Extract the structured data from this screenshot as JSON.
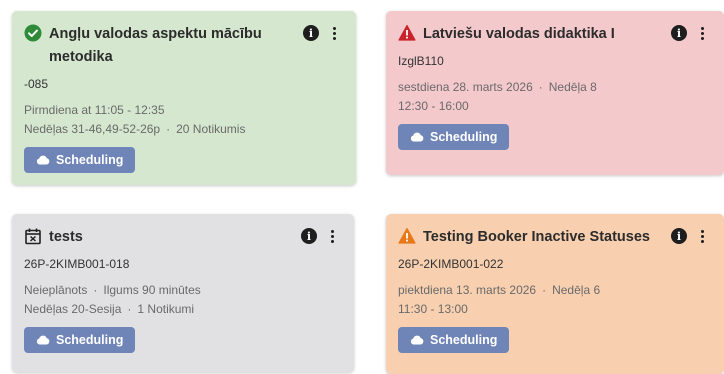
{
  "cards": [
    {
      "title": "Angļu valodas aspektu mācību metodika",
      "code": "-085",
      "line1": "Pirmdiena at 11:05 - 12:35",
      "line2a": "Nedēļas 31-46,49-52-26p",
      "line2b": "20 Notikumis",
      "separator": "·",
      "button": "Scheduling",
      "status_icon": "check-circle-icon",
      "color": "#d5e7cf"
    },
    {
      "title": "Latviešu valodas didaktika I",
      "code": "IzglB110",
      "line1a": "sestdiena 28. marts 2026",
      "line1b": "Nedēļa 8",
      "line2": "12:30 - 16:00",
      "separator": "·",
      "button": "Scheduling",
      "status_icon": "warning-triangle-icon",
      "color": "#f4c9cc"
    },
    {
      "title": "tests",
      "code": "26P-2KIMB001-018",
      "line1a": "Neieplānots",
      "line1b": "Ilgums 90 minūtes",
      "line2a": "Nedēļas 20-Sesija",
      "line2b": "1 Notikumi",
      "separator": "·",
      "button": "Scheduling",
      "status_icon": "calendar-x-icon",
      "color": "#e1e1e3"
    },
    {
      "title": "Testing Booker Inactive Statuses",
      "code": "26P-2KIMB001-022",
      "line1a": "piektdiena 13. marts 2026",
      "line1b": "Nedēļa 6",
      "line2": "11:30 - 13:00",
      "separator": "·",
      "button": "Scheduling",
      "status_icon": "warning-triangle-icon",
      "color": "#f8d0b0"
    }
  ],
  "colors": {
    "button": "#6f84b7",
    "success": "#2f8a3a",
    "error": "#c8242c",
    "warning": "#e8781a"
  }
}
